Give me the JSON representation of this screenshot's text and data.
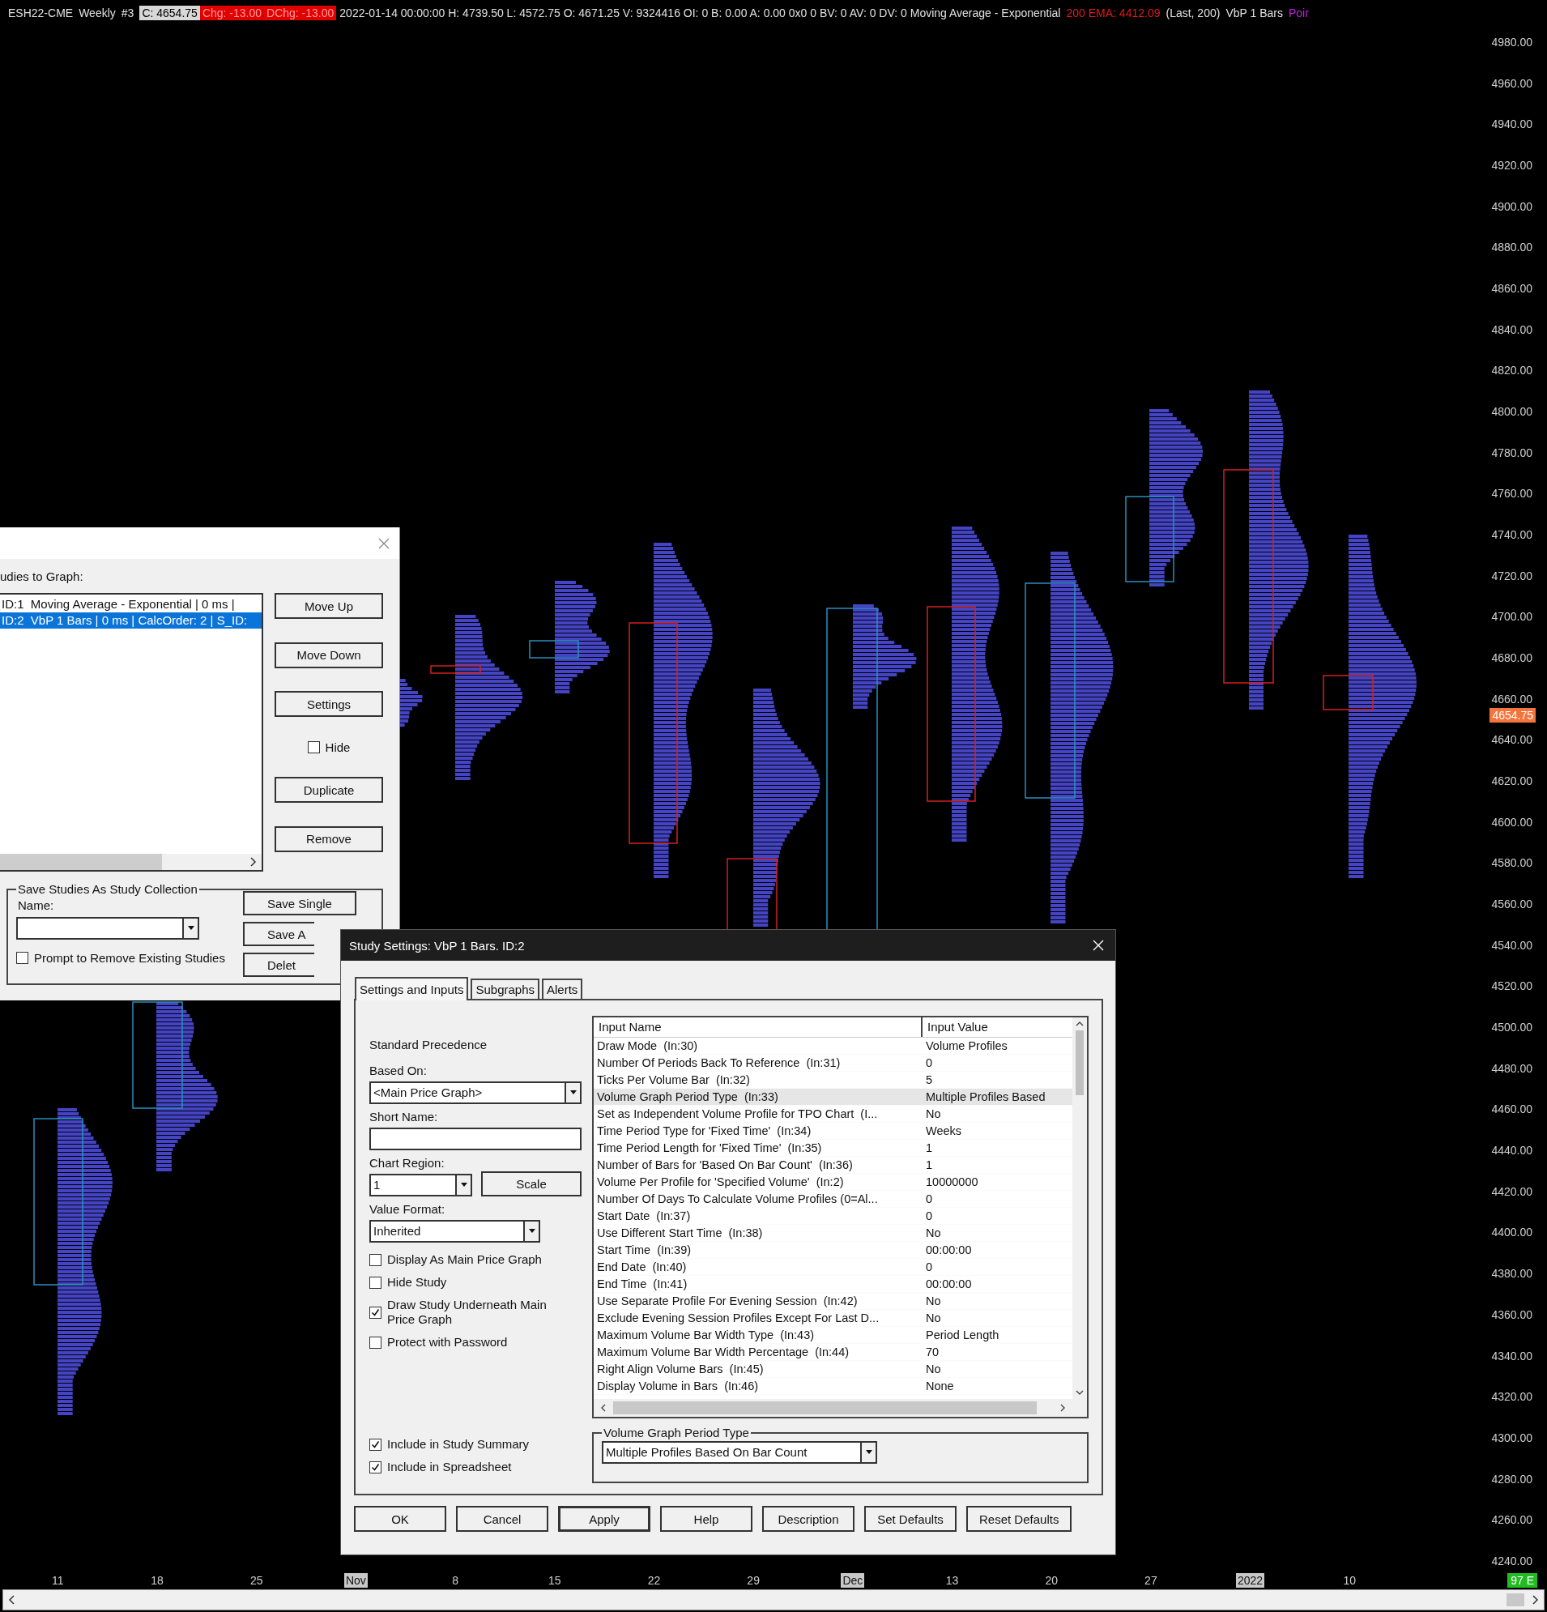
{
  "header": {
    "segments": [
      {
        "text": "ESH22-CME",
        "kind": "plain"
      },
      {
        "text": "Weekly",
        "kind": "plain"
      },
      {
        "text": "#3",
        "kind": "plain"
      },
      {
        "text": "C: 4654.75",
        "kind": "boxed"
      },
      {
        "text": "Chg: -13.00",
        "kind": "negative"
      },
      {
        "text": "DChg: -13.00",
        "kind": "negative"
      },
      {
        "text": "2022-01-14 00:00:00 H: 4739.50 L: 4572.75 O: 4671.25 V: 9324416 OI: 0 B: 0.00 A: 0.00 0x0 0 BV: 0 AV: 0 DV: 0 Moving Average - Exponential",
        "kind": "plain"
      },
      {
        "text": "200 EMA: 4412.09",
        "kind": "alert"
      },
      {
        "text": "(Last, 200)",
        "kind": "plain"
      },
      {
        "text": "VbP 1 Bars",
        "kind": "plain"
      },
      {
        "text": "Poir",
        "kind": "accent"
      }
    ]
  },
  "price_axis": {
    "labels": [
      "4980.00",
      "4960.00",
      "4940.00",
      "4920.00",
      "4900.00",
      "4880.00",
      "4860.00",
      "4840.00",
      "4820.00",
      "4800.00",
      "4780.00",
      "4760.00",
      "4740.00",
      "4720.00",
      "4700.00",
      "4680.00",
      "4660.00",
      "4640.00",
      "4620.00",
      "4600.00",
      "4580.00",
      "4560.00",
      "4540.00",
      "4520.00",
      "4500.00",
      "4480.00",
      "4460.00",
      "4440.00",
      "4420.00",
      "4400.00",
      "4380.00",
      "4360.00",
      "4340.00",
      "4320.00",
      "4300.00",
      "4280.00",
      "4260.00",
      "4240.00"
    ],
    "current_price": "4654.75"
  },
  "date_axis": {
    "labels": [
      {
        "text": "11",
        "kind": "day"
      },
      {
        "text": "18",
        "kind": "day"
      },
      {
        "text": "25",
        "kind": "day"
      },
      {
        "text": "Nov",
        "kind": "period"
      },
      {
        "text": "8",
        "kind": "day"
      },
      {
        "text": "15",
        "kind": "day"
      },
      {
        "text": "22",
        "kind": "day"
      },
      {
        "text": "29",
        "kind": "day"
      },
      {
        "text": "Dec",
        "kind": "period"
      },
      {
        "text": "13",
        "kind": "day"
      },
      {
        "text": "20",
        "kind": "day"
      },
      {
        "text": "27",
        "kind": "day"
      },
      {
        "text": "2022",
        "kind": "period"
      },
      {
        "text": "10",
        "kind": "day"
      }
    ],
    "badge": "97 E"
  },
  "studies_dialog": {
    "list_label": "udies to Graph:",
    "studies": [
      {
        "text": "ID:1  Moving Average - Exponential | 0 ms |",
        "selected": false
      },
      {
        "text": "ID:2  VbP 1 Bars | 0 ms | CalcOrder: 2 | S_ID:",
        "selected": true
      }
    ],
    "side_controls": [
      {
        "kind": "button",
        "label": "Move Up"
      },
      {
        "kind": "button",
        "label": "Move Down"
      },
      {
        "kind": "button",
        "label": "Settings"
      },
      {
        "kind": "checkbox",
        "label": "Hide",
        "checked": false
      },
      {
        "kind": "button",
        "label": "Duplicate"
      },
      {
        "kind": "button",
        "label": "Remove"
      }
    ],
    "collection": {
      "title": "Save Studies As Study Collection",
      "name_label": "Name:",
      "prompt": {
        "label": "Prompt to Remove Existing Studies",
        "checked": false
      },
      "buttons": [
        {
          "label": "Save Single",
          "cut": false
        },
        {
          "label": "Save A",
          "cut": true
        },
        {
          "label": "Delet",
          "cut": true
        }
      ]
    }
  },
  "settings_dialog": {
    "title": "Study Settings: VbP 1 Bars. ID:2",
    "tabs": [
      {
        "label": "Settings and Inputs",
        "selected": true
      },
      {
        "label": "Subgraphs",
        "selected": false
      },
      {
        "label": "Alerts",
        "selected": false
      }
    ],
    "precedence": "Standard Precedence",
    "based_on": {
      "label": "Based On:",
      "value": "<Main Price Graph>"
    },
    "short_name": {
      "label": "Short Name:"
    },
    "chart_region": {
      "label": "Chart Region:",
      "value": "1"
    },
    "scale_button": "Scale",
    "value_format": {
      "label": "Value Format:",
      "value": "Inherited"
    },
    "options": [
      {
        "label": "Display As Main Price Graph",
        "checked": false
      },
      {
        "label": "Hide Study",
        "checked": false
      },
      {
        "label": "Draw Study Underneath Main Price Graph",
        "checked": true
      },
      {
        "label": "Protect with Password",
        "checked": false
      }
    ],
    "summary_options": [
      {
        "label": "Include in Study Summary",
        "checked": true
      },
      {
        "label": "Include in Spreadsheet",
        "checked": true
      }
    ],
    "table": {
      "columns": [
        "Input Name",
        "Input Value"
      ],
      "rows": [
        {
          "name": "Draw Mode  (In:30)",
          "value": "Volume Profiles",
          "selected": false
        },
        {
          "name": "Number Of Periods Back To Reference  (In:31)",
          "value": "0",
          "selected": false
        },
        {
          "name": "Ticks Per Volume Bar  (In:32)",
          "value": "5",
          "selected": false
        },
        {
          "name": "Volume Graph Period Type  (In:33)",
          "value": "Multiple Profiles Based",
          "selected": true
        },
        {
          "name": "Set as Independent Volume Profile for TPO Chart  (I...",
          "value": "No",
          "selected": false
        },
        {
          "name": "Time Period Type for 'Fixed Time'  (In:34)",
          "value": "Weeks",
          "selected": false
        },
        {
          "name": "Time Period Length for 'Fixed Time'  (In:35)",
          "value": "1",
          "selected": false
        },
        {
          "name": "Number of Bars for 'Based On Bar Count'  (In:36)",
          "value": "1",
          "selected": false
        },
        {
          "name": "Volume Per Profile for 'Specified Volume'  (In:2)",
          "value": "10000000",
          "selected": false
        },
        {
          "name": "Number Of Days To Calculate Volume Profiles (0=Al...",
          "value": "0",
          "selected": false
        },
        {
          "name": "Start Date  (In:37)",
          "value": "0",
          "selected": false
        },
        {
          "name": "Use Different Start Time  (In:38)",
          "value": "No",
          "selected": false
        },
        {
          "name": "Start Time  (In:39)",
          "value": "00:00:00",
          "selected": false
        },
        {
          "name": "End Date  (In:40)",
          "value": "0",
          "selected": false
        },
        {
          "name": "End Time  (In:41)",
          "value": "00:00:00",
          "selected": false
        },
        {
          "name": "Use Separate Profile For Evening Session  (In:42)",
          "value": "No",
          "selected": false
        },
        {
          "name": "Exclude Evening Session Profiles Except For Last D...",
          "value": "No",
          "selected": false
        },
        {
          "name": "Maximum Volume Bar Width Type  (In:43)",
          "value": "Period Length",
          "selected": false
        },
        {
          "name": "Maximum Volume Bar Width Percentage  (In:44)",
          "value": "70",
          "selected": false
        },
        {
          "name": "Right Align Volume Bars  (In:45)",
          "value": "No",
          "selected": false
        },
        {
          "name": "Display Volume in Bars  (In:46)",
          "value": "None",
          "selected": false
        }
      ]
    },
    "period_type": {
      "title": "Volume Graph Period Type",
      "value": "Multiple Profiles Based On Bar Count"
    },
    "buttons": [
      {
        "label": "OK",
        "default": false
      },
      {
        "label": "Cancel",
        "default": false
      },
      {
        "label": "Apply",
        "default": true
      },
      {
        "label": "Help",
        "default": false
      },
      {
        "label": "Description",
        "default": false
      },
      {
        "label": "Set Defaults",
        "default": false
      },
      {
        "label": "Reset Defaults",
        "default": false
      }
    ]
  }
}
